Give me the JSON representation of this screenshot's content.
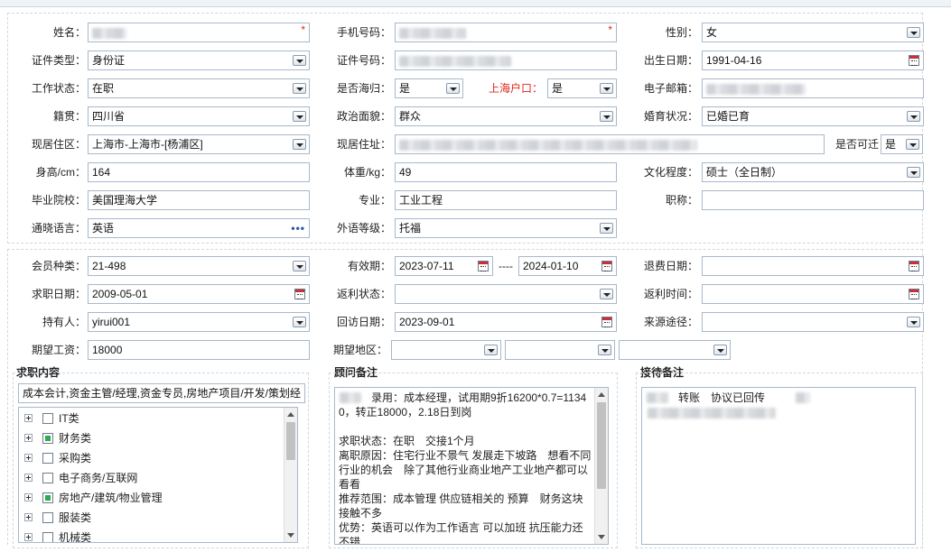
{
  "personal": {
    "name_label": "姓名：",
    "mobile_label": "手机号码：",
    "gender_label": "性别：",
    "gender": "女",
    "id_type_label": "证件类型：",
    "id_type": "身份证",
    "id_no_label": "证件号码：",
    "birth_label": "出生日期：",
    "birth": "1991-04-16",
    "work_status_label": "工作状态：",
    "work_status": "在职",
    "returnee_label": "是否海归：",
    "returnee": "是",
    "hukou_label": "上海户口：",
    "hukou": "是",
    "email_label": "电子邮箱：",
    "native_label": "籍贯：",
    "native": "四川省",
    "politics_label": "政治面貌：",
    "politics": "群众",
    "marital_label": "婚育状况：",
    "marital": "已婚已育",
    "residence_area_label": "现居住区：",
    "residence_area": "上海市-上海市-[杨浦区]",
    "address_label": "现居住址：",
    "relocate_label": "是否可迁",
    "relocate": "是",
    "height_label": "身高/cm：",
    "height": "164",
    "weight_label": "体重/kg：",
    "weight": "49",
    "education_label": "文化程度：",
    "education": "硕士（全日制）",
    "school_label": "毕业院校：",
    "school": "美国理海大学",
    "major_label": "专业：",
    "major": "工业工程",
    "title_label": "职称：",
    "title": "",
    "language_label": "通晓语言：",
    "language": "英语",
    "foreign_level_label": "外语等级：",
    "foreign_level": "托福"
  },
  "membership": {
    "member_type_label": "会员种类：",
    "member_type": "21-498",
    "validity_label": "有效期：",
    "valid_from": "2023-07-11",
    "valid_sep": "----",
    "valid_to": "2024-01-10",
    "refund_date_label": "退费日期：",
    "refund_date": "",
    "job_date_label": "求职日期：",
    "job_date": "2009-05-01",
    "rebate_status_label": "返利状态：",
    "rebate_status": "",
    "rebate_time_label": "返利时间：",
    "rebate_time": "",
    "holder_label": "持有人：",
    "holder": "yirui001",
    "revisit_label": "回访日期：",
    "revisit": "2023-09-01",
    "source_label": "来源途径：",
    "source": "",
    "expected_salary_label": "期望工资：",
    "expected_salary": "18000",
    "expected_area_label": "期望地区："
  },
  "job_content": {
    "title": "求职内容",
    "summary": "成本会计,资金主管/经理,资金专员,房地产项目/开发/策划经",
    "tree": [
      {
        "label": "IT类",
        "checked": false
      },
      {
        "label": "财务类",
        "checked": true
      },
      {
        "label": "采购类",
        "checked": false
      },
      {
        "label": "电子商务/互联网",
        "checked": false
      },
      {
        "label": "房地产/建筑/物业管理",
        "checked": true
      },
      {
        "label": "服装类",
        "checked": false
      },
      {
        "label": "机械类",
        "checked": false
      }
    ]
  },
  "consultant_note": {
    "title": "顾问备注",
    "text": "　　　录用：成本经理，试用期9折16200*0.7=11340，转正18000，2.18日到岗\n\n求职状态：在职　交接1个月\n离职原因：住宅行业不景气 发展走下坡路　想看不同行业的机会　除了其他行业商业地产工业地产都可以看看\n推荐范围：成本管理 供应链相关的 预算　财务这块接触不多\n优势：英语可以作为工作语言 可以加班 抗压能力还不错"
  },
  "reception_note": {
    "title": "接待备注",
    "text": "　　　转账　协议已回传"
  },
  "colors": {
    "required": "#e0241a",
    "border": "#a9b8c8",
    "checked": "#2fa84f"
  }
}
